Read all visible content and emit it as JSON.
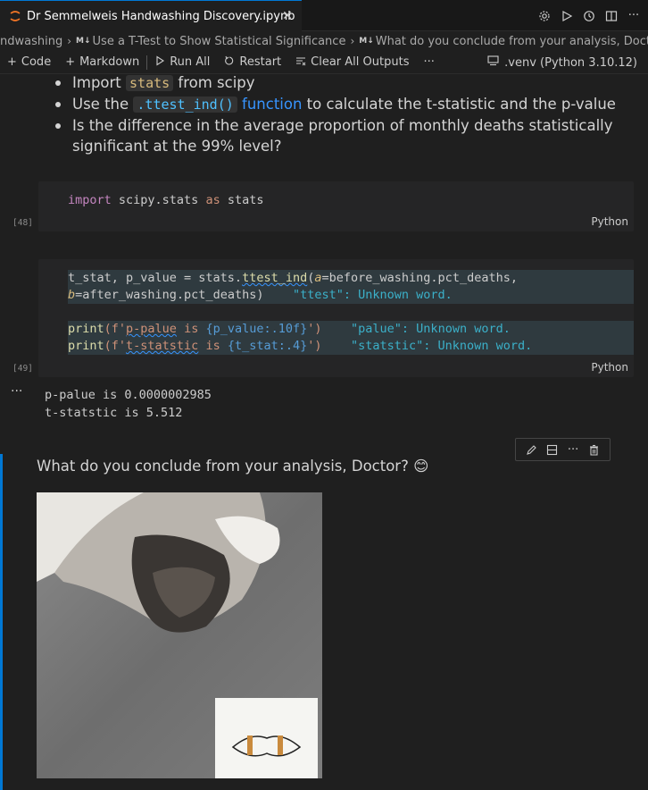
{
  "tab": {
    "title": "Dr Semmelweis Handwashing Discovery.ipynb",
    "close_glyph": "✕"
  },
  "tab_actions": [
    "gear-icon",
    "run-icon",
    "history-icon",
    "split-editor-icon",
    "more-icon"
  ],
  "breadcrumb": {
    "items": [
      {
        "label": "ndwashing",
        "marker": ""
      },
      {
        "label": "Use a T-Test to Show Statistical Significance",
        "marker": "M↓"
      },
      {
        "label": "What do you conclude from your analysis, Doctor? 😊",
        "marker": "M↓"
      }
    ]
  },
  "toolbar": {
    "code_label": "Code",
    "markdown_label": "Markdown",
    "run_all_label": "Run All",
    "restart_label": "Restart",
    "clear_outputs_label": "Clear All Outputs",
    "more_label": "···",
    "kernel_label": ".venv (Python 3.10.12)"
  },
  "markdown_list": {
    "item1_pre": "Import ",
    "item1_code": "stats",
    "item1_post": " from scipy",
    "item2_pre": "Use the ",
    "item2_code": ".ttest_ind()",
    "item2_link": " function",
    "item2_post": " to calculate the t-statistic and the p-value",
    "item3": "Is the difference in the average proportion of monthly deaths statistically significant at the 99% level?"
  },
  "cell48": {
    "exec_count": "[48]",
    "language": "Python",
    "code": {
      "kw_import": "import",
      "mod": " scipy.stats ",
      "kw_as": "as",
      "alias": " stats"
    }
  },
  "cell49": {
    "exec_count": "[49]",
    "language": "Python",
    "line1_a": "t_stat, p_value = stats.",
    "line1_fn": "ttest_ind",
    "line1_b": "(",
    "line1_param_a": "a",
    "line1_c": "=before_washing.pct_deaths,",
    "line2_param_b": "b",
    "line2_c": "=after_washing.pct_deaths)",
    "line2_warn": "\"ttest\": Unknown word.",
    "line3_fn": "print",
    "line3_str_a": "(f'",
    "line3_word": "p-palue",
    "line3_str_b": " is ",
    "line3_brace": "{p_value:.10f}",
    "line3_str_c": "')",
    "line3_warn": "\"palue\": Unknown word.",
    "line4_fn": "print",
    "line4_str_a": "(f'",
    "line4_word": "t-statstic",
    "line4_str_b": " is ",
    "line4_brace": "{t_stat:.4}",
    "line4_str_c": "')",
    "line4_warn": "\"statstic\": Unknown word."
  },
  "output49": {
    "dots": "···",
    "lines": [
      "p-palue is 0.0000002985",
      "t-statstic is 5.512"
    ]
  },
  "md_cell": {
    "heading": "What do you conclude from your analysis, Doctor? 😊",
    "toolbar_icons": [
      "edit-icon",
      "split-cell-icon",
      "more-icon",
      "trash-icon"
    ]
  },
  "colors": {
    "accent": "#0078d4",
    "background": "#1f1f1f",
    "cell_background": "#252526"
  }
}
